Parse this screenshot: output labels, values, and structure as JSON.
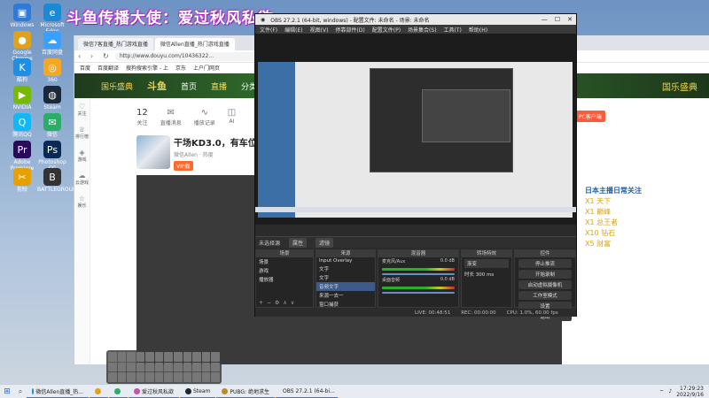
{
  "overlay": {
    "caption": "斗鱼传播大使：爱过秋风私欲"
  },
  "desktop_icons": [
    {
      "label": "Windows",
      "color": "#2f7ad6",
      "glyph": "▣"
    },
    {
      "label": "Microsoft Edge",
      "color": "#1b8ad6",
      "glyph": "e"
    },
    {
      "label": "Google Chrome",
      "color": "#e0a21a",
      "glyph": "●"
    },
    {
      "label": "百度网盘",
      "color": "#3aa0ff",
      "glyph": "☁"
    },
    {
      "label": "酷狗",
      "color": "#1f8fe5",
      "glyph": "K"
    },
    {
      "label": "360",
      "color": "#f5a623",
      "glyph": "◎"
    },
    {
      "label": "NVIDIA",
      "color": "#76b900",
      "glyph": "▶"
    },
    {
      "label": "Steam",
      "color": "#1b2838",
      "glyph": "◍"
    },
    {
      "label": "腾讯QQ",
      "color": "#12b7f5",
      "glyph": "Q"
    },
    {
      "label": "微信",
      "color": "#2aae67",
      "glyph": "✉"
    },
    {
      "label": "Adobe Premiere Pro",
      "color": "#2a0b5a",
      "glyph": "Pr"
    },
    {
      "label": "Photoshop CC",
      "color": "#0a2a56",
      "glyph": "Ps"
    },
    {
      "label": "剪映",
      "color": "#e6a000",
      "glyph": "✂"
    },
    {
      "label": "BATTLEGROUNDS",
      "color": "#333",
      "glyph": "B"
    }
  ],
  "browser": {
    "tabs": [
      "微信7客直播_热门游戏直播",
      "微信Allen直播_热门游戏直播"
    ],
    "url": "http://www.douyu.com/10436322...",
    "bookmarks": [
      "百度",
      "百度翻译",
      "搜狗搜索引擎 - 上",
      "京东",
      "上户门网页"
    ],
    "nav": {
      "logo": "斗鱼",
      "items": [
        "首页",
        "直播",
        "分类"
      ]
    },
    "left_nav": [
      "关注",
      "排行榜",
      "游戏",
      "云游戏",
      "娱乐"
    ],
    "stats": [
      {
        "value": "12",
        "label": "关注"
      },
      {
        "value": "",
        "label": "直播消息"
      },
      {
        "value": "",
        "label": "播放记录"
      },
      {
        "value": "",
        "label": "AI"
      }
    ],
    "streamer": {
      "title": "干场KD3.0，有车位",
      "sub": "微信Allen · 热度",
      "badges": [
        "VIP舰"
      ]
    },
    "pc_button": "PC客户端",
    "banner_right": "国乐盛典"
  },
  "promo": {
    "lines": [
      "日本主播日常关注",
      "X1 天下",
      "X1 巅峰",
      "X1 总王者",
      "X10 钻石",
      "X5 财富"
    ],
    "side": "斗鱼"
  },
  "obs": {
    "title": "OBS 27.2.1 (64-bit, windows) - 配置文件: 未命名 - 场景: 未命名",
    "menu": [
      "文件(F)",
      "编辑(E)",
      "视图(V)",
      "停靠部件(D)",
      "配置文件(P)",
      "场景集合(S)",
      "工具(T)",
      "帮助(H)"
    ],
    "scene_bar": {
      "label": "未选择源",
      "buttons": [
        "属性",
        "滤镜"
      ]
    },
    "docks": {
      "scenes": {
        "header": "场景",
        "items": [
          "场景",
          "游戏",
          "播放器"
        ]
      },
      "sources": {
        "header": "来源",
        "items": [
          "Input Overlay",
          "文字",
          "文字",
          "音频文字",
          "来源一去一",
          "窗口捕获"
        ]
      },
      "mixer": {
        "header": "混音器",
        "items": [
          {
            "name": "麦克风/Aux",
            "db": "0.0 dB"
          },
          {
            "name": "桌面音频",
            "db": "0.0 dB"
          }
        ]
      },
      "transitions": {
        "header": "转场特效",
        "type": "渐变",
        "duration_label": "时长",
        "duration": "300 ms"
      },
      "controls": {
        "header": "控件",
        "buttons": [
          "停止推流",
          "开始录制",
          "启动虚拟摄像机",
          "工作室模式",
          "设置",
          "退出"
        ]
      }
    },
    "status": [
      "LIVE: 00:48:51",
      "REC: 00:00:00",
      "CPU: 1.0%, 60.00 fps"
    ]
  },
  "taskbar": {
    "items": [
      {
        "label": "微信Allen直播_热...",
        "color": "#1b8ad6"
      },
      {
        "label": "",
        "color": "#e0a21a"
      },
      {
        "label": "",
        "color": "#2aae67"
      },
      {
        "label": "爱过秋风私欲",
        "color": "#d04fa8"
      },
      {
        "label": "Steam",
        "color": "#1b2838"
      },
      {
        "label": "PUBG: 绝地求生",
        "color": "#c08a2a"
      },
      {
        "label": "OBS 27.2.1 (64-bi...",
        "color": "#3a3a3a"
      }
    ],
    "time": "17:29:23",
    "date": "2022/9/16"
  }
}
